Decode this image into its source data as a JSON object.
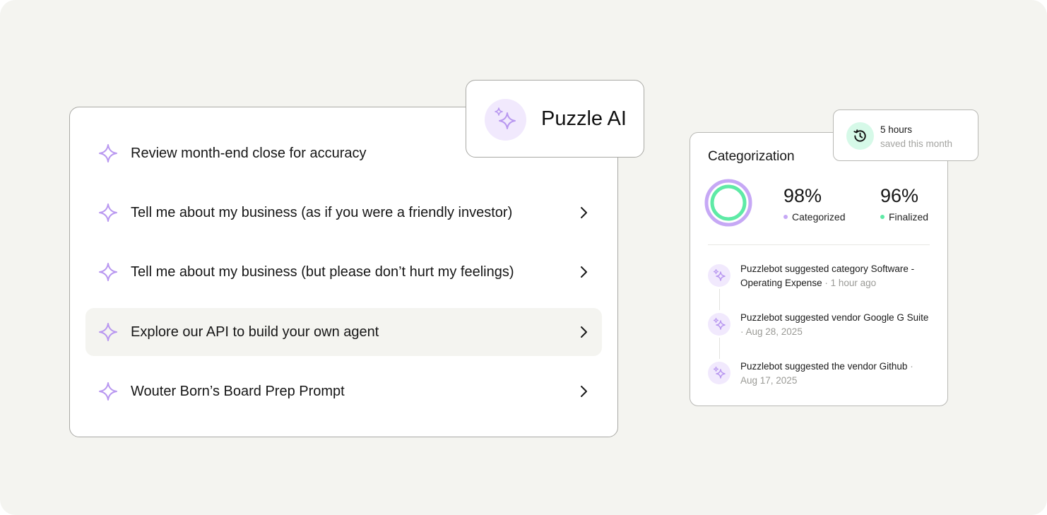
{
  "prompts": [
    {
      "label": "Review month-end close for accuracy",
      "has_chevron": false
    },
    {
      "label": "Tell me about my business (as if you were a friendly investor)",
      "has_chevron": true
    },
    {
      "label": "Tell me about my business (but please don’t hurt my feelings)",
      "has_chevron": true
    },
    {
      "label": "Explore our API to build your own agent",
      "has_chevron": true,
      "highlighted": true
    },
    {
      "label": "Wouter Born’s Board Prep Prompt",
      "has_chevron": true
    }
  ],
  "ai_badge": {
    "title": "Puzzle AI",
    "icon": "sparkle-icon"
  },
  "hours_saved": {
    "value": "5 hours",
    "caption": "saved this month",
    "icon": "history-icon"
  },
  "categorization": {
    "title": "Categorization",
    "stats": [
      {
        "percent": "98%",
        "label": "Categorized",
        "color": "#c6a8f5"
      },
      {
        "percent": "96%",
        "label": "Finalized",
        "color": "#5eeaa6"
      }
    ],
    "activity": [
      {
        "text": "Puzzlebot suggested category Software - Operating Expense",
        "meta": "· 1 hour ago"
      },
      {
        "text": "Puzzlebot suggested vendor Google G Suite",
        "meta": "· Aug 28, 2025"
      },
      {
        "text": "Puzzlebot suggested the vendor Github",
        "meta": "· Aug 17, 2025"
      }
    ]
  },
  "colors": {
    "accent_purple": "#b998f0",
    "accent_green": "#5eeaa6",
    "background": "#f4f4f0"
  }
}
